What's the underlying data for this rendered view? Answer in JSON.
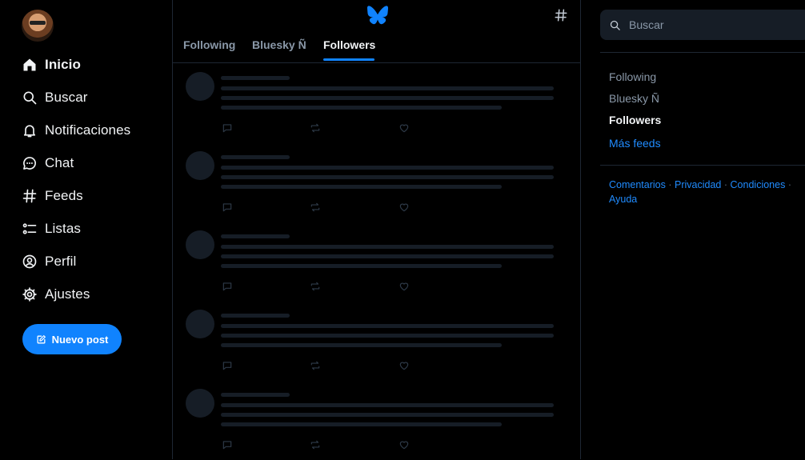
{
  "nav": {
    "items": [
      {
        "label": "Inicio",
        "icon": "home-icon",
        "active": true
      },
      {
        "label": "Buscar",
        "icon": "search-icon"
      },
      {
        "label": "Notificaciones",
        "icon": "bell-icon"
      },
      {
        "label": "Chat",
        "icon": "chat-bubble-icon"
      },
      {
        "label": "Feeds",
        "icon": "hash-icon"
      },
      {
        "label": "Listas",
        "icon": "list-icon"
      },
      {
        "label": "Perfil",
        "icon": "user-circle-icon"
      },
      {
        "label": "Ajustes",
        "icon": "gear-icon"
      }
    ],
    "new_post_label": "Nuevo post"
  },
  "center": {
    "tabs": [
      {
        "label": "Following"
      },
      {
        "label": "Bluesky Ñ"
      },
      {
        "label": "Followers",
        "active": true
      }
    ],
    "loading_placeholders": 5
  },
  "right": {
    "search_placeholder": "Buscar",
    "feeds": [
      {
        "label": "Following"
      },
      {
        "label": "Bluesky Ñ"
      },
      {
        "label": "Followers",
        "active": true
      },
      {
        "label": "Más feeds",
        "link": true
      }
    ],
    "footer_links": [
      "Comentarios",
      "Privacidad",
      "Condiciones",
      "Ayuda"
    ],
    "footer_separator": "·"
  },
  "colors": {
    "accent": "#1083fe",
    "background": "#000000",
    "skeleton": "#161d26",
    "muted_text": "#8a98a8",
    "link": "#208bfe"
  }
}
